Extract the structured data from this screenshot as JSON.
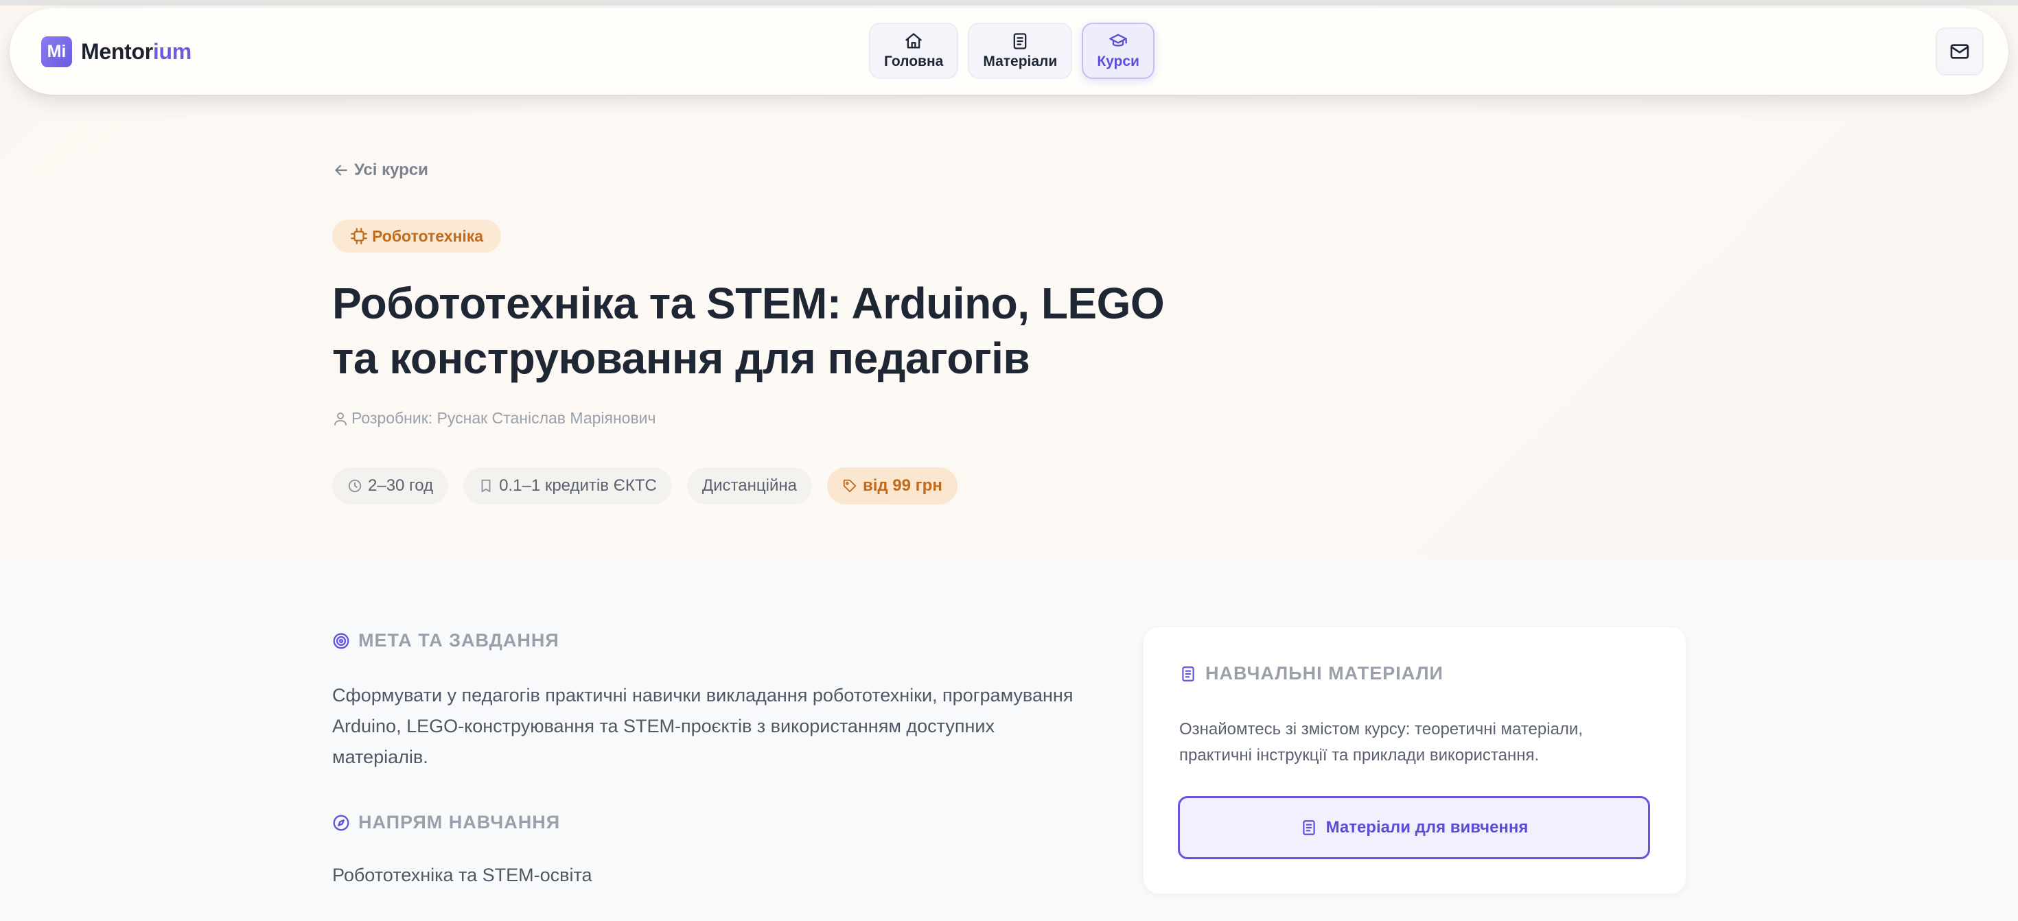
{
  "brand": {
    "mark": "Mi",
    "name_prefix": "Mentor",
    "name_suffix": "ium",
    "accent_color": "#6a5cdd"
  },
  "nav": {
    "items": [
      {
        "label": "Головна",
        "icon": "home-icon",
        "active": false
      },
      {
        "label": "Матеріали",
        "icon": "book-icon",
        "active": false
      },
      {
        "label": "Курси",
        "icon": "graduation-cap-icon",
        "active": true
      }
    ],
    "mail_icon": "mail-icon"
  },
  "course": {
    "back_label": "Усі курси",
    "category": "Робототехніка",
    "title_line1": "Робототехніка та STEM: Arduino, LEGO",
    "title_line2": "та конструювання для педагогів",
    "developer": "Розробник: Руснак Станіслав Маріянович",
    "chips": {
      "duration": "2–30 год",
      "credits": "0.1–1 кредитів ЄКТС",
      "format": "Дистанційна",
      "price": "від 99 грн"
    }
  },
  "goal": {
    "heading": "МЕТА ТА ЗАВДАННЯ",
    "line1": "Сформувати у педагогів практичні навички викладання робототехніки, програмування",
    "line2": "Arduino, LEGO-конструювання та STEM-проєктів з використанням доступних",
    "line3": "матеріалів."
  },
  "direction": {
    "heading": "НАПРЯМ НАВЧАННЯ",
    "value": "Робототехніка та STEM-освіта"
  },
  "materials_card": {
    "heading": "НАВЧАЛЬНІ МАТЕРІАЛИ",
    "line1": "Ознайомтесь зі змістом курсу: теоретичні матеріали,",
    "line2": "практичні інструкції та приклади використання.",
    "button_label": "Матеріали для вивчення"
  },
  "colors": {
    "primary": "#6456dc",
    "category_bg": "#fbe9d4",
    "category_text": "#c06a1c",
    "heading_text": "#1f2634"
  }
}
